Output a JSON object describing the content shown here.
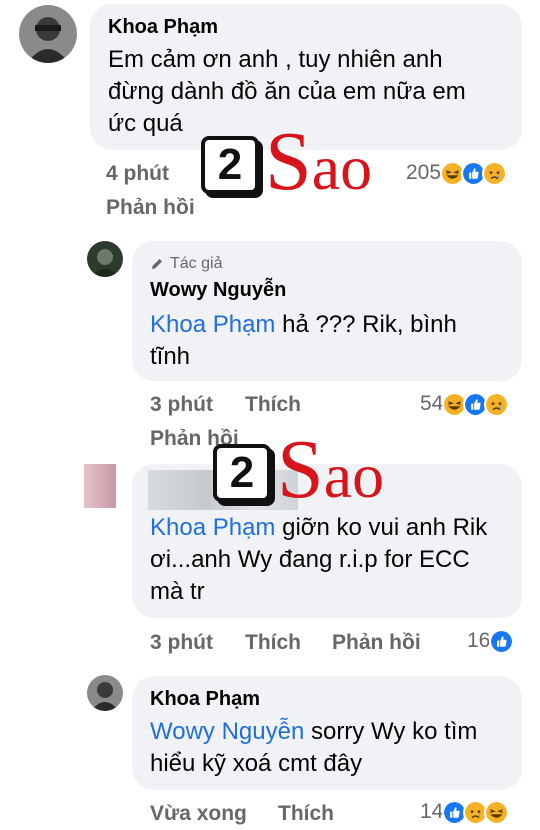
{
  "colors": {
    "bubble": "#f0f2f5",
    "mention": "#216fdb",
    "meta": "#65676b",
    "watermark_red": "#d7141c"
  },
  "comments": [
    {
      "author": "Khoa Phạm",
      "text": "Em cảm ơn anh , tuy nhiên anh đừng dành đồ ăn của em nữa em ức quá",
      "time": "4 phút",
      "reply": "Phản hồi",
      "reaction_count": "205",
      "reactions": [
        "haha-icon",
        "like-icon",
        "sad-icon"
      ]
    },
    {
      "badge": "Tác giả",
      "author": "Wowy Nguyễn",
      "mention": "Khoa Phạm",
      "text": " hả ??? Rik, bình tĩnh",
      "time": "3 phút",
      "like": "Thích",
      "reply": "Phản hồi",
      "reaction_count": "54",
      "reactions": [
        "haha-icon",
        "like-icon",
        "sad-icon"
      ]
    },
    {
      "mention": "Khoa Phạm",
      "text": " giỡn ko vui anh Rik ơi...anh Wy đang r.i.p for ECC mà tr",
      "time": "3 phút",
      "like": "Thích",
      "reply": "Phản hồi",
      "reaction_count": "16",
      "reactions": [
        "like-icon"
      ]
    },
    {
      "author": "Khoa Phạm",
      "mention": "Wowy Nguyễn",
      "text": " sorry Wy ko tìm hiểu kỹ xoá cmt đây",
      "time": "Vừa xong",
      "like": "Thích",
      "reaction_count": "14",
      "reactions": [
        "like-icon",
        "sad-icon",
        "haha-icon"
      ]
    }
  ],
  "watermark": {
    "number": "2",
    "brand_first": "S",
    "brand_rest": "ao"
  }
}
